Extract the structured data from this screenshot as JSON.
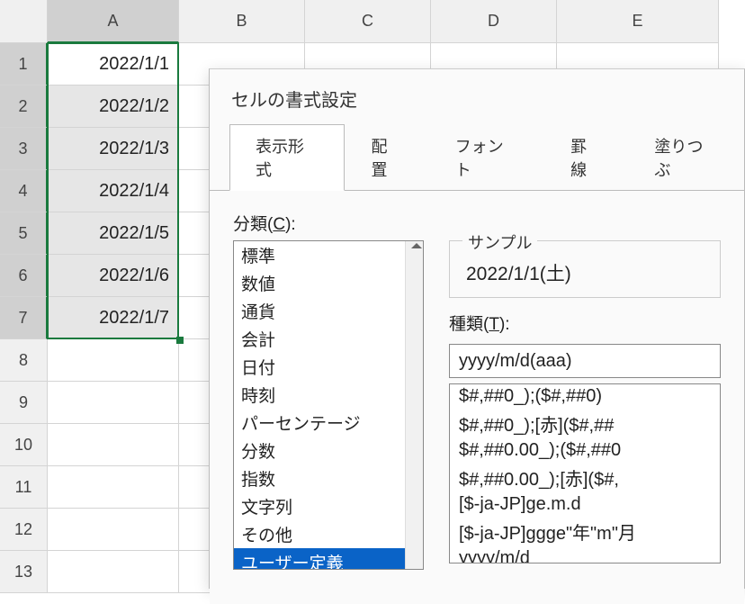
{
  "sheet": {
    "columns": [
      "A",
      "B",
      "C",
      "D",
      "E"
    ],
    "rows": [
      "1",
      "2",
      "3",
      "4",
      "5",
      "6",
      "7",
      "8",
      "9",
      "10",
      "11",
      "12",
      "13"
    ],
    "cells": {
      "A1": "2022/1/1",
      "A2": "2022/1/2",
      "A3": "2022/1/3",
      "A4": "2022/1/4",
      "A5": "2022/1/5",
      "A6": "2022/1/6",
      "A7": "2022/1/7"
    },
    "selectedColumn": "A",
    "selectedRows": [
      "1",
      "2",
      "3",
      "4",
      "5",
      "6",
      "7"
    ],
    "activeCell": "A1"
  },
  "dialog": {
    "title": "セルの書式設定",
    "tabs": [
      "表示形式",
      "配置",
      "フォント",
      "罫線",
      "塗りつぶ"
    ],
    "activeTab": 0,
    "categoryLabelPrefix": "分類(",
    "categoryLabelKey": "C",
    "categoryLabelSuffix": "):",
    "categories": [
      "標準",
      "数値",
      "通貨",
      "会計",
      "日付",
      "時刻",
      "パーセンテージ",
      "分数",
      "指数",
      "文字列",
      "その他",
      "ユーザー定義"
    ],
    "selectedCategoryIndex": 11,
    "sampleLabel": "サンプル",
    "sampleValue": "2022/1/1(土)",
    "typeLabelPrefix": "種類(",
    "typeLabelKey": "T",
    "typeLabelSuffix": "):",
    "typeInput": "yyyy/m/d(aaa)",
    "typeList": [
      "$#,##0_);($#,##0)",
      "$#,##0_);[赤]($#,##",
      "$#,##0.00_);($#,##0",
      "$#,##0.00_);[赤]($#,",
      "[$-ja-JP]ge.m.d",
      "[$-ja-JP]ggge\"年\"m\"月",
      "yyyy/m/d"
    ]
  }
}
